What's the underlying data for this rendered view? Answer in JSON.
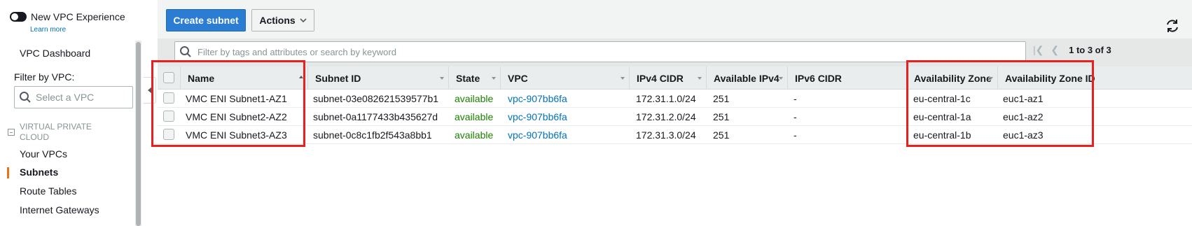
{
  "sidebar": {
    "toggle_label": "New VPC Experience",
    "learn_more": "Learn more",
    "dashboard": "VPC Dashboard",
    "filter_label": "Filter by VPC:",
    "select_placeholder": "Select a VPC",
    "section_label": "VIRTUAL PRIVATE CLOUD",
    "items": [
      {
        "label": "Your VPCs"
      },
      {
        "label": "Subnets"
      },
      {
        "label": "Route Tables"
      },
      {
        "label": "Internet Gateways"
      }
    ]
  },
  "toolbar": {
    "create_subnet": "Create subnet",
    "actions": "Actions"
  },
  "filter": {
    "placeholder": "Filter by tags and attributes or search by keyword",
    "pagination": "1 to 3 of 3"
  },
  "table": {
    "columns": [
      "Name",
      "Subnet ID",
      "State",
      "VPC",
      "IPv4 CIDR",
      "Available IPv4",
      "IPv6 CIDR",
      "Availability Zone",
      "Availability Zone ID"
    ],
    "rows": [
      {
        "name": "VMC ENI Subnet1-AZ1",
        "subnet_id": "subnet-03e082621539577b1",
        "state": "available",
        "vpc": "vpc-907bb6fa",
        "ipv4": "172.31.1.0/24",
        "avail_ipv4": "251",
        "ipv6": "-",
        "az": "eu-central-1c",
        "az_id": "euc1-az1"
      },
      {
        "name": "VMC ENI Subnet2-AZ2",
        "subnet_id": "subnet-0a1177433b435627d",
        "state": "available",
        "vpc": "vpc-907bb6fa",
        "ipv4": "172.31.2.0/24",
        "avail_ipv4": "251",
        "ipv6": "-",
        "az": "eu-central-1a",
        "az_id": "euc1-az2"
      },
      {
        "name": "VMC ENI Subnet3-AZ3",
        "subnet_id": "subnet-0c8c1fb2f543a8bb1",
        "state": "available",
        "vpc": "vpc-907bb6fa",
        "ipv4": "172.31.3.0/24",
        "avail_ipv4": "251",
        "ipv6": "-",
        "az": "eu-central-1b",
        "az_id": "euc1-az3"
      }
    ]
  },
  "colors": {
    "primary_button": "#2a7dd3",
    "state_available": "#1d8102",
    "link": "#0073bb",
    "highlight": "#e8201f",
    "active_nav_marker": "#ec7211"
  }
}
